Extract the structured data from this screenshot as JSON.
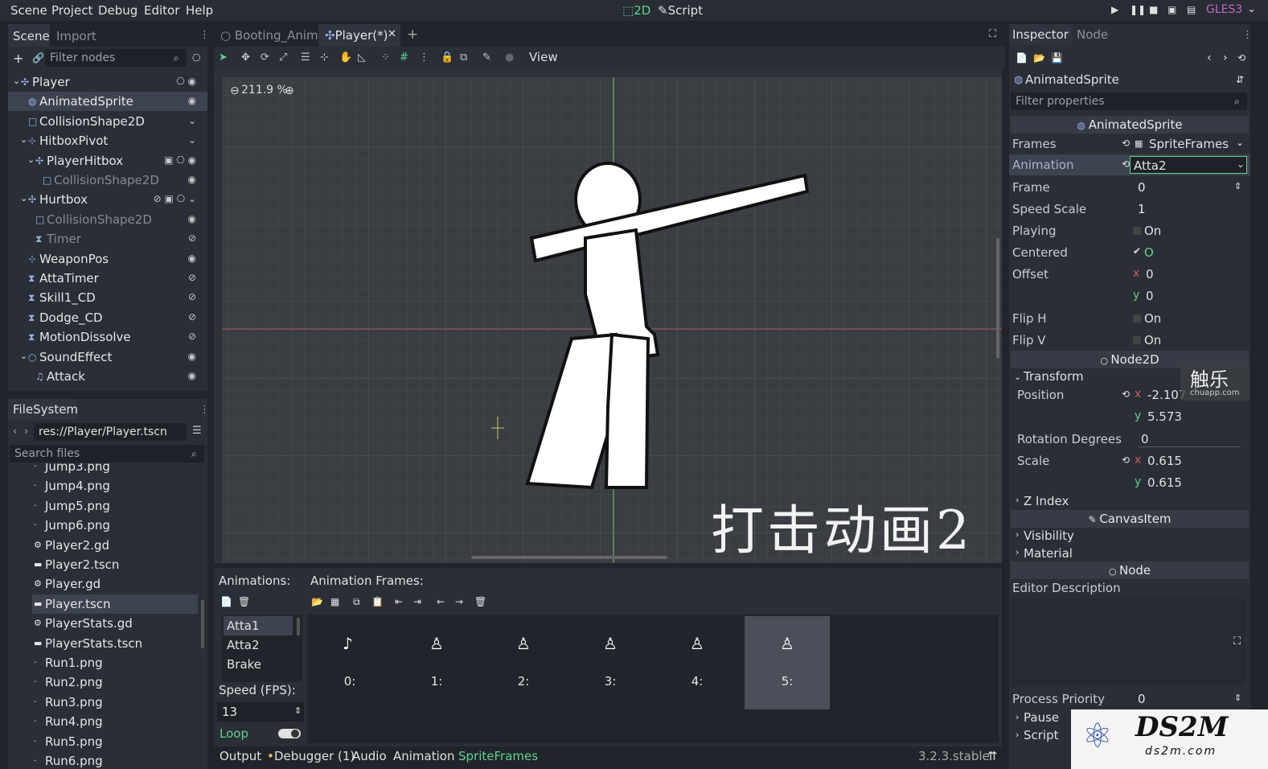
{
  "menu": [
    "Scene",
    "Project",
    "Debug",
    "Editor",
    "Help"
  ],
  "modes": {
    "twod": "2D",
    "script": "Script"
  },
  "renderer": "GLES3",
  "scene_dock": {
    "tabs": [
      "Scene",
      "Import"
    ],
    "filter_placeholder": "Filter nodes",
    "nodes": [
      {
        "label": "Player",
        "indent": 0,
        "icon": "node2d-icon"
      },
      {
        "label": "AnimatedSprite",
        "indent": 1,
        "icon": "sprite-icon"
      },
      {
        "label": "CollisionShape2D",
        "indent": 1,
        "icon": "shape-icon"
      },
      {
        "label": "HitboxPivot",
        "indent": 1,
        "icon": "pivot-icon"
      },
      {
        "label": "PlayerHitbox",
        "indent": 2,
        "icon": "area-icon"
      },
      {
        "label": "CollisionShape2D",
        "indent": 3,
        "icon": "shape-icon"
      },
      {
        "label": "Hurtbox",
        "indent": 1,
        "icon": "area-icon"
      },
      {
        "label": "CollisionShape2D",
        "indent": 2,
        "icon": "shape-icon"
      },
      {
        "label": "Timer",
        "indent": 2,
        "icon": "timer-icon"
      },
      {
        "label": "WeaponPos",
        "indent": 1,
        "icon": "pivot-icon"
      },
      {
        "label": "AttaTimer",
        "indent": 1,
        "icon": "timer-icon"
      },
      {
        "label": "Skill1_CD",
        "indent": 1,
        "icon": "timer-icon"
      },
      {
        "label": "Dodge_CD",
        "indent": 1,
        "icon": "timer-icon"
      },
      {
        "label": "MotionDissolve",
        "indent": 1,
        "icon": "timer-icon"
      },
      {
        "label": "SoundEffect",
        "indent": 1,
        "icon": "node-icon"
      },
      {
        "label": "Attack",
        "indent": 2,
        "icon": "audio-icon"
      }
    ]
  },
  "filesystem": {
    "title": "FileSystem",
    "path": "res://Player/Player.tscn",
    "search_placeholder": "Search files",
    "files": [
      "Jump3.png",
      "Jump4.png",
      "Jump5.png",
      "Jump6.png",
      "Player2.gd",
      "Player2.tscn",
      "Player.gd",
      "Player.tscn",
      "PlayerStats.gd",
      "PlayerStats.tscn",
      "Run1.png",
      "Run2.png",
      "Run3.png",
      "Run4.png",
      "Run5.png",
      "Run6.png"
    ]
  },
  "editor_tabs": [
    "Booting_Anime",
    "Player(*)"
  ],
  "toolbar": {
    "view": "View"
  },
  "viewport": {
    "zoom": "211.9 %",
    "overlay_text": "打击动画2"
  },
  "animation_panel": {
    "animations_label": "Animations:",
    "frames_label": "Animation Frames:",
    "animations": [
      "Atta1",
      "Atta2",
      "Brake"
    ],
    "speed_label": "Speed (FPS):",
    "speed_value": "13",
    "loop_label": "Loop",
    "frames": [
      "0:",
      "1:",
      "2:",
      "3:",
      "4:",
      "5:"
    ]
  },
  "bottom_tabs": [
    "Output",
    "Debugger (1)",
    "Audio",
    "Animation",
    "SpriteFrames"
  ],
  "version": "3.2.3.stable",
  "inspector": {
    "tabs": [
      "Inspector",
      "Node"
    ],
    "object": "AnimatedSprite",
    "filter_placeholder": "Filter properties",
    "section_sprite": "AnimatedSprite",
    "props": {
      "frames_k": "Frames",
      "frames_v": "SpriteFrames",
      "animation_k": "Animation",
      "animation_v": "Atta2",
      "frame_k": "Frame",
      "frame_v": "0",
      "speed_k": "Speed Scale",
      "speed_v": "1",
      "playing_k": "Playing",
      "playing_v": "On",
      "centered_k": "Centered",
      "centered_v": "O",
      "offset_k": "Offset",
      "offset_x": "0",
      "offset_y": "0",
      "fliph_k": "Flip H",
      "fliph_v": "On",
      "flipv_k": "Flip V",
      "flipv_v": "On"
    },
    "section_node2d": "Node2D",
    "transform": "Transform",
    "position_k": "Position",
    "position_x": "-2.107",
    "position_y": "5.573",
    "rotation_k": "Rotation Degrees",
    "rotation_v": "0",
    "scale_k": "Scale",
    "scale_x": "0.615",
    "scale_y": "0.615",
    "zindex": "Z Index",
    "section_canvas": "CanvasItem",
    "visibility": "Visibility",
    "material": "Material",
    "section_node": "Node",
    "editor_desc": "Editor Description",
    "process_priority_k": "Process Priority",
    "process_priority_v": "0",
    "pause": "Pause",
    "script": "Script"
  },
  "watermarks": {
    "chule": "触乐",
    "chule_sub": "chuapp.com",
    "ds2m": "DS2M",
    "ds2m_sub": "ds2m.com"
  }
}
